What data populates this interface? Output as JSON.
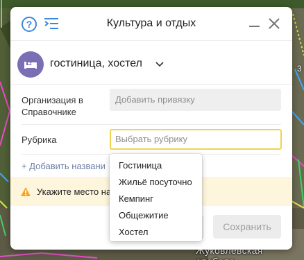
{
  "map": {
    "place_label": "Жуковлевская слобода",
    "edge_label": "3"
  },
  "dialog": {
    "title": "Культура и отдых",
    "object_type": "гостиница, хостел",
    "organization_label": "Организация в Справочнике",
    "organization_placeholder": "Добавить привязку",
    "rubric_label": "Рубрика",
    "rubric_placeholder": "Выбрать рубрику",
    "add_name_link": "+ Добавить названи",
    "notice_text": "Укажите место на",
    "save_button": "Сохранить"
  },
  "dropdown": {
    "options": [
      "Гостиница",
      "Жильё посуточно",
      "Кемпинг",
      "Общежитие",
      "Хостел"
    ]
  },
  "colors": {
    "accent_blue": "#3a87e0",
    "avatar_purple": "#7a6fb5",
    "focus_yellow": "#f0d54a",
    "notice_bg": "#fdf5dc",
    "warning_orange": "#f5a623"
  }
}
